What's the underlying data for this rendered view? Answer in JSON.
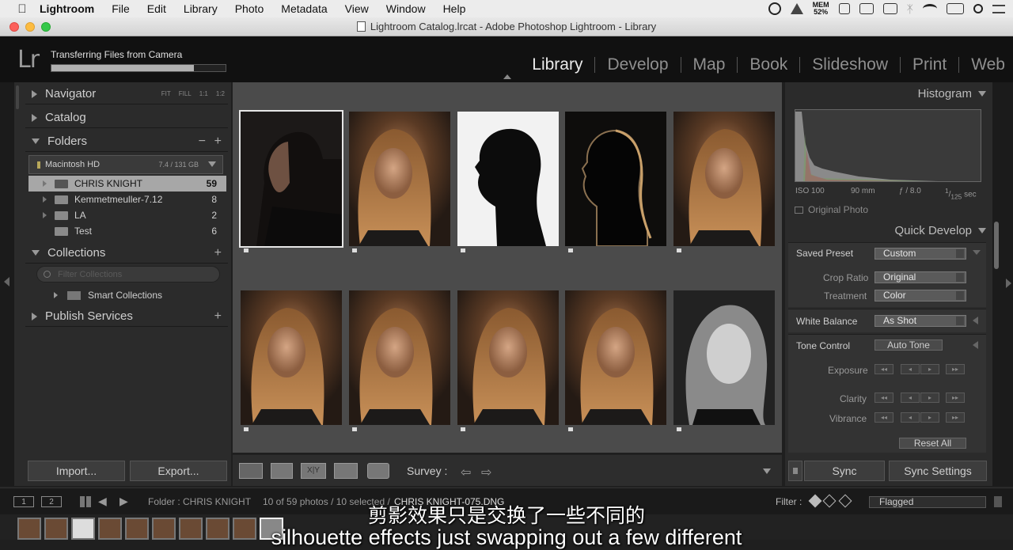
{
  "menubar": {
    "app": "Lightroom",
    "items": [
      "File",
      "Edit",
      "Library",
      "Photo",
      "Metadata",
      "View",
      "Window",
      "Help"
    ],
    "mem_label": "MEM",
    "mem_value": "52%"
  },
  "window": {
    "title": "Lightroom Catalog.lrcat - Adobe Photoshop Lightroom - Library"
  },
  "header": {
    "logo": "Lr",
    "transfer_text": "Transferring Files from Camera",
    "transfer_progress": 0.82,
    "modules": [
      "Library",
      "Develop",
      "Map",
      "Book",
      "Slideshow",
      "Print",
      "Web"
    ],
    "active_module": "Library"
  },
  "left": {
    "navigator": {
      "label": "Navigator",
      "zooms": [
        "FIT",
        "FILL",
        "1:1",
        "1:2"
      ]
    },
    "catalog": {
      "label": "Catalog"
    },
    "folders": {
      "label": "Folders",
      "volume": {
        "name": "Macintosh HD",
        "size": "7.4 / 131 GB"
      },
      "items": [
        {
          "name": "CHRIS KNIGHT",
          "count": "59"
        },
        {
          "name": "Kemmetmeuller-7.12",
          "count": "8"
        },
        {
          "name": "LA",
          "count": "2"
        },
        {
          "name": "Test",
          "count": "6"
        }
      ]
    },
    "collections": {
      "label": "Collections",
      "filter_placeholder": "Filter Collections",
      "smart": "Smart Collections"
    },
    "publish": {
      "label": "Publish Services"
    },
    "import_label": "Import...",
    "export_label": "Export..."
  },
  "grid": {
    "photos": [
      {
        "style": "dark-profile",
        "selected": true
      },
      {
        "style": "warm-closeup"
      },
      {
        "style": "silhouette"
      },
      {
        "style": "rim-light"
      },
      {
        "style": "warm-portrait"
      },
      {
        "style": "warm-side"
      },
      {
        "style": "warm-side2"
      },
      {
        "style": "smile"
      },
      {
        "style": "front"
      },
      {
        "style": "bw"
      }
    ]
  },
  "toolbar": {
    "survey_label": "Survey :"
  },
  "right": {
    "histogram": {
      "label": "Histogram",
      "iso": "ISO 100",
      "focal": "90 mm",
      "aperture": "ƒ / 8.0",
      "shutter_num": "1",
      "shutter_den": "125",
      "shutter_unit": "sec",
      "original_photo": "Original Photo"
    },
    "quick_develop": {
      "label": "Quick Develop",
      "saved_preset_label": "Saved Preset",
      "saved_preset_value": "Custom",
      "crop_label": "Crop Ratio",
      "crop_value": "Original",
      "treatment_label": "Treatment",
      "treatment_value": "Color",
      "wb_label": "White Balance",
      "wb_value": "As Shot",
      "tone_label": "Tone Control",
      "auto_tone": "Auto Tone",
      "exposure": "Exposure",
      "clarity": "Clarity",
      "vibrance": "Vibrance",
      "reset": "Reset All"
    },
    "sync_label": "Sync",
    "sync_settings_label": "Sync Settings"
  },
  "filmbar": {
    "screen1": "1",
    "screen2": "2",
    "folder_text": "Folder : CHRIS KNIGHT",
    "count_text": "10 of 59 photos / 10 selected /",
    "file_text": "CHRIS KNIGHT-075.DNG",
    "filter_label": "Filter :",
    "filter_value": "Flagged"
  },
  "subtitles": {
    "cn": "剪影效果只是交换了一些不同的",
    "en": "silhouette effects just swapping out a few different"
  },
  "colors": {
    "bg": "#1f1f1f",
    "panel": "#2b2b2b",
    "grid": "#4b4b4b"
  }
}
